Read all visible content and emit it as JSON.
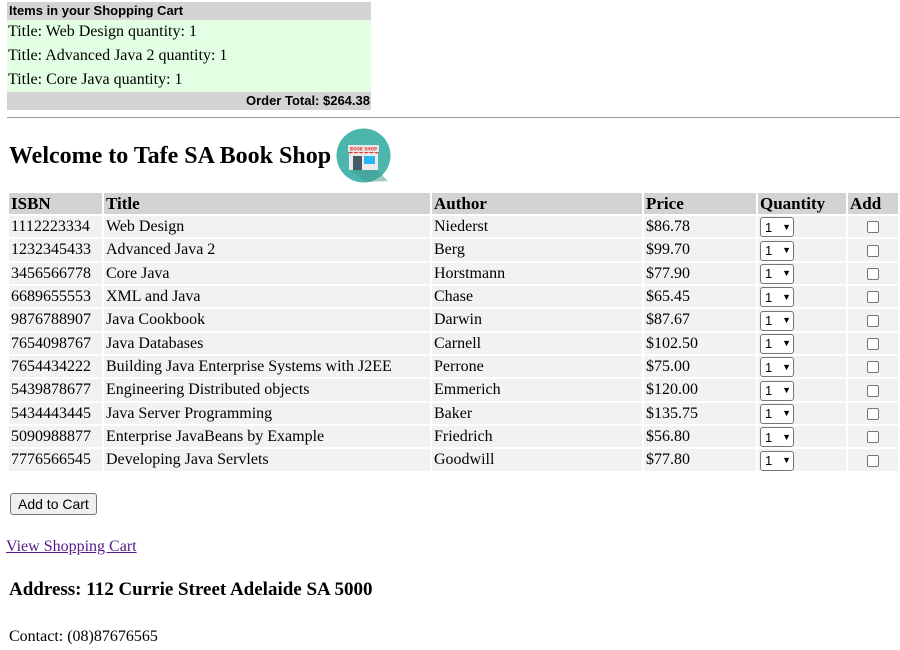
{
  "cart": {
    "heading": "Items in your Shopping Cart",
    "items": [
      "Title: Web Design quantity: 1",
      "Title: Advanced Java 2 quantity: 1",
      "Title: Core Java quantity: 1"
    ],
    "total": "Order Total: $264.38"
  },
  "welcome": "Welcome to Tafe SA Book Shop",
  "shop_icon": "book-shop-storefront-icon",
  "shop_sign_text": "BOOK SHOP",
  "table": {
    "headers": [
      "ISBN",
      "Title",
      "Author",
      "Price",
      "Quantity",
      "Add"
    ],
    "rows": [
      {
        "isbn": "1112223334",
        "title": "Web Design",
        "author": "Niederst",
        "price": "$86.78",
        "qty": "1"
      },
      {
        "isbn": "1232345433",
        "title": "Advanced Java 2",
        "author": "Berg",
        "price": "$99.70",
        "qty": "1"
      },
      {
        "isbn": "3456566778",
        "title": "Core Java",
        "author": "Horstmann",
        "price": "$77.90",
        "qty": "1"
      },
      {
        "isbn": "6689655553",
        "title": "XML and Java",
        "author": "Chase",
        "price": "$65.45",
        "qty": "1"
      },
      {
        "isbn": "9876788907",
        "title": "Java Cookbook",
        "author": "Darwin",
        "price": "$87.67",
        "qty": "1"
      },
      {
        "isbn": "7654098767",
        "title": "Java Databases",
        "author": "Carnell",
        "price": "$102.50",
        "qty": "1"
      },
      {
        "isbn": "7654434222",
        "title": "Building Java Enterprise Systems with J2EE",
        "author": "Perrone",
        "price": "$75.00",
        "qty": "1"
      },
      {
        "isbn": "5439878677",
        "title": "Engineering Distributed objects",
        "author": "Emmerich",
        "price": "$120.00",
        "qty": "1"
      },
      {
        "isbn": "5434443445",
        "title": "Java Server Programming",
        "author": "Baker",
        "price": "$135.75",
        "qty": "1"
      },
      {
        "isbn": "5090988877",
        "title": "Enterprise JavaBeans by Example",
        "author": "Friedrich",
        "price": "$56.80",
        "qty": "1"
      },
      {
        "isbn": "7776566545",
        "title": "Developing Java Servlets",
        "author": "Goodwill",
        "price": "$77.80",
        "qty": "1"
      }
    ]
  },
  "add_button": "Add to Cart",
  "view_cart_link": "View Shopping Cart",
  "address": "Address: 112 Currie Street Adelaide SA 5000",
  "contact": "Contact: (08)87676565",
  "colors": {
    "cart_item_bg": "#e3ffe3",
    "header_bg": "#d3d3d3",
    "row_bg": "#f2f2f2",
    "icon_circle": "#4db6ac",
    "visited_link": "#551a8b"
  }
}
